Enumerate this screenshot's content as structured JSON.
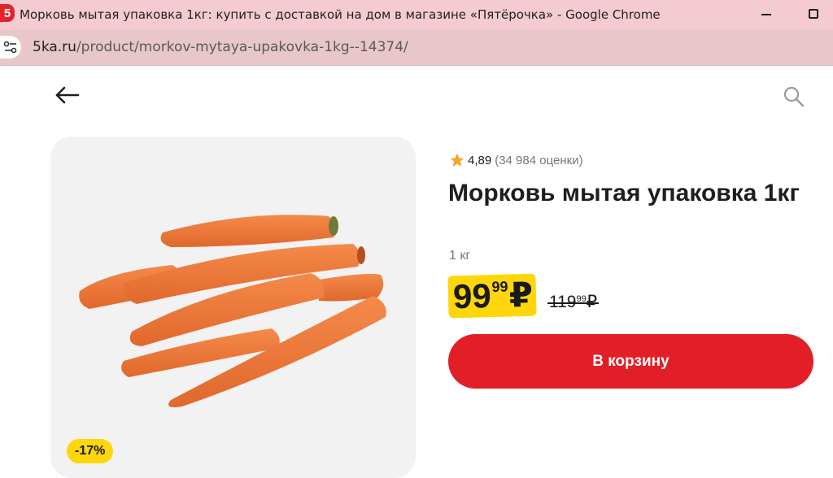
{
  "window": {
    "favicon_text": "5",
    "title": "Морковь мытая упаковка 1кг: купить с доставкой на дом в магазине «Пятёрочка» - Google Chrome"
  },
  "address_bar": {
    "domain": "5ka.ru",
    "path": "/product/morkov-mytaya-upakovka-1kg--14374/"
  },
  "nav": {
    "back_icon": "arrow-left-icon",
    "search_icon": "search-icon"
  },
  "product": {
    "discount_badge": "-17%",
    "rating_value": "4,89",
    "rating_count": "(34 984 оценки)",
    "title": "Морковь мытая упаковка 1кг",
    "weight": "1 кг",
    "price_integer": "99",
    "price_fraction": "99",
    "currency": "₽",
    "old_price_integer": "119",
    "old_price_fraction": "99",
    "old_price_currency": "₽",
    "add_to_cart_label": "В корзину"
  },
  "colors": {
    "brand_red": "#e21f26",
    "price_yellow": "#ffd60a",
    "star": "#f5a623"
  }
}
